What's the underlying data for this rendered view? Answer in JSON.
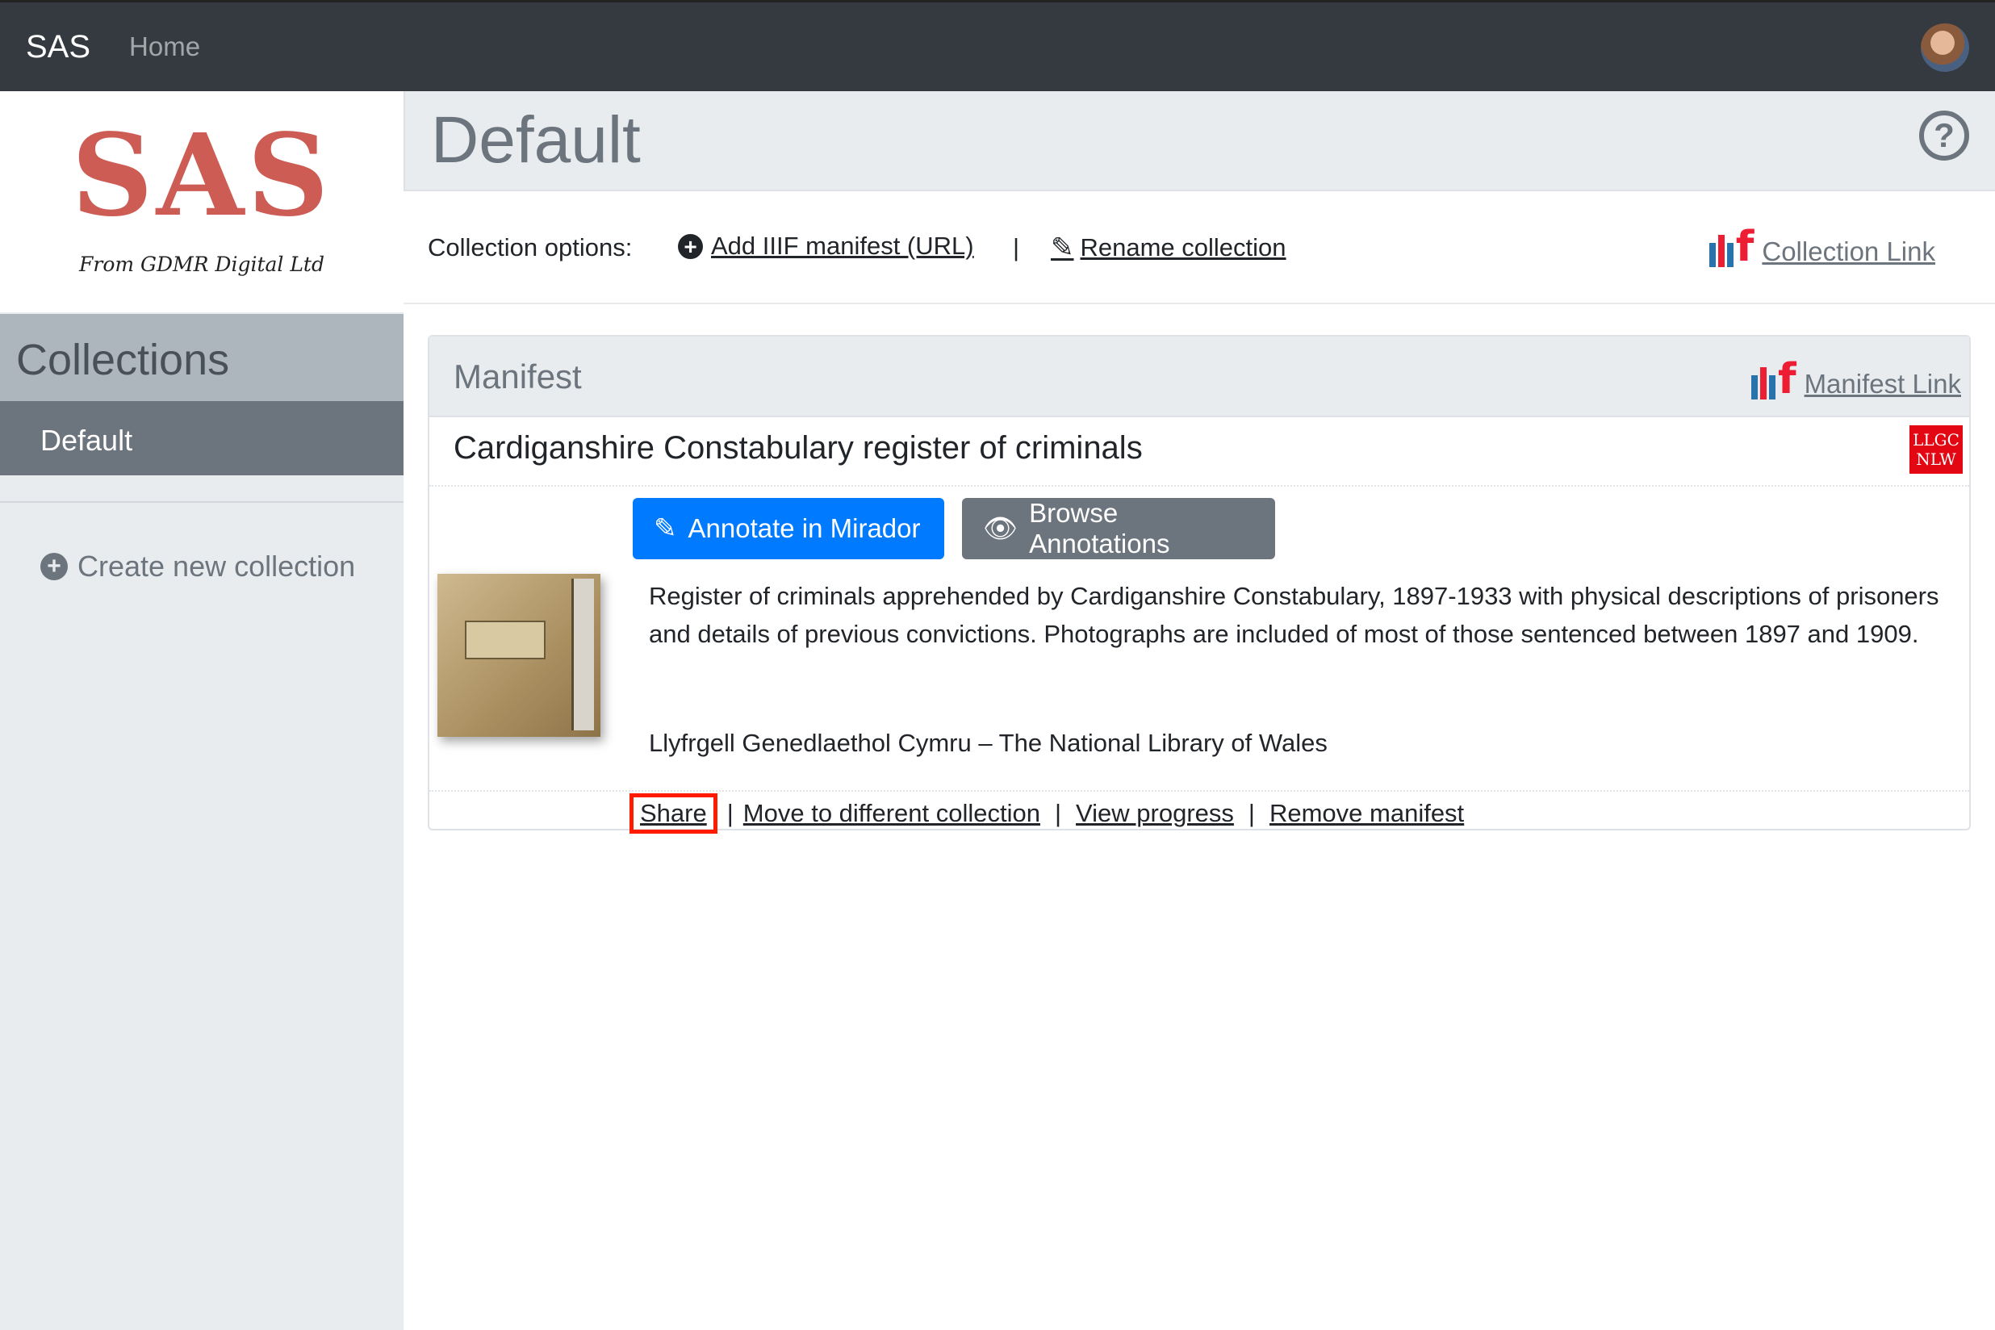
{
  "navbar": {
    "brand": "SAS",
    "home": "Home"
  },
  "sidebar": {
    "logo_text": "SAS",
    "logo_subtitle": "From GDMR Digital Ltd",
    "collections_title": "Collections",
    "items": [
      {
        "label": "Default",
        "active": true
      }
    ],
    "create_label": "Create new collection"
  },
  "main": {
    "title": "Default",
    "options": {
      "label": "Collection options:",
      "add_manifest": "Add IIIF manifest (URL)",
      "separator": "|",
      "rename": "Rename collection",
      "collection_link": "Collection Link"
    },
    "manifest_card": {
      "header": "Manifest",
      "manifest_link": "Manifest Link",
      "title": "Cardiganshire Constabulary register of criminals",
      "provider_logo_text": "LLGC NLW",
      "annotate_button": "Annotate in Mirador",
      "browse_button": "Browse Annotations",
      "description": "Register of criminals apprehended by Cardiganshire Constabulary, 1897-1933 with physical descriptions of prisoners and details of previous convictions. Photographs are included of most of those sentenced between 1897 and 1909.",
      "holder": "Llyfrgell Genedlaethol Cymru – The National Library of Wales",
      "actions": {
        "share": "Share",
        "move": "Move to different collection",
        "progress": "View progress",
        "remove": "Remove manifest",
        "separator": "|"
      }
    }
  },
  "colors": {
    "navbar": "#343a40",
    "logo": "#cd5c55",
    "primary": "#007bff",
    "secondary": "#6c757d",
    "highlight": "#ff1a00",
    "iiif_blue": "#2873ab",
    "iiif_red": "#ed1d33"
  },
  "icons": {
    "help": "question-circle-icon",
    "add": "plus-circle-icon",
    "rename": "pencil-icon",
    "annotate": "edit-icon",
    "browse": "eye-icon"
  }
}
